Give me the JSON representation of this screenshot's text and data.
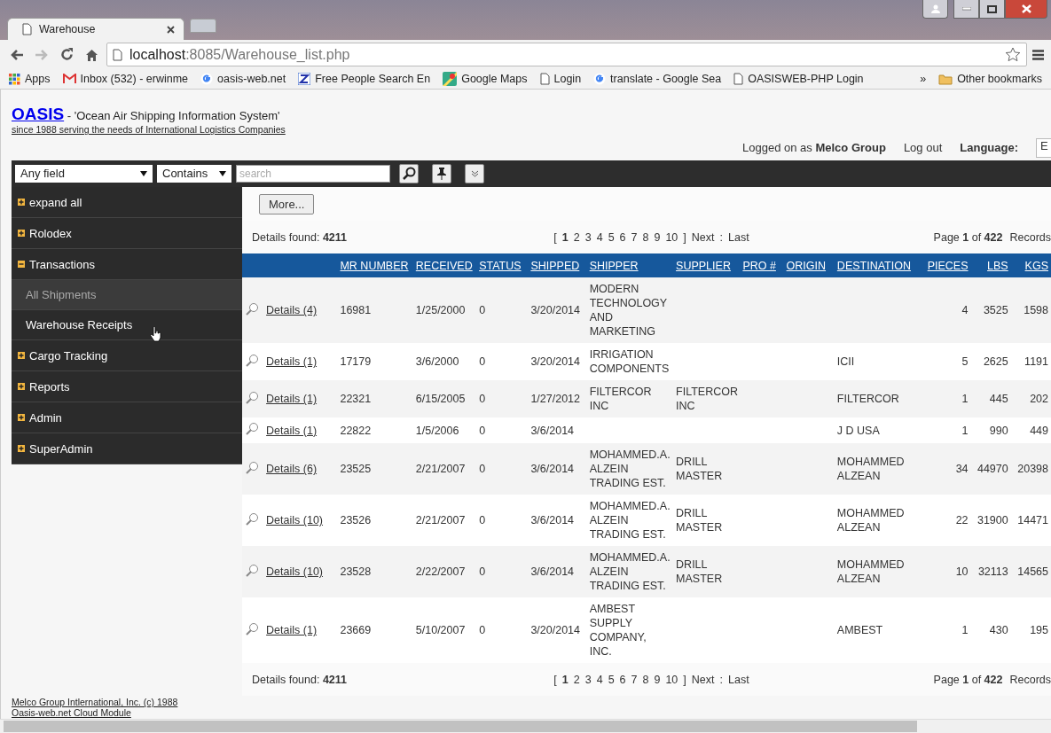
{
  "browser": {
    "tabs": [
      {
        "title": "Warehouse",
        "selected": true
      }
    ],
    "url_host": "localhost",
    "url_path": ":8085/Warehouse_list.php",
    "bookmarks": [
      {
        "kind": "apps",
        "label": "Apps"
      },
      {
        "kind": "mail",
        "label": "Inbox (532) - erwinme"
      },
      {
        "kind": "google",
        "label": "oasis-web.net"
      },
      {
        "kind": "z",
        "label": "Free People Search En"
      },
      {
        "kind": "maps",
        "label": "Google Maps"
      },
      {
        "kind": "page",
        "label": "Login"
      },
      {
        "kind": "google",
        "label": "translate - Google Sea"
      },
      {
        "kind": "page",
        "label": "OASISWEB-PHP Login"
      }
    ],
    "overflow": "»",
    "other_bookmarks": "Other bookmarks"
  },
  "header": {
    "logo": "OASIS",
    "tagline": " - 'Ocean Air Shipping Information System'",
    "subtitle": "since 1988 serving the needs of International Logistics Companies",
    "logged_on": "Logged on as **Melco Group**",
    "logout": "Log out",
    "language_label": "Language:",
    "language_value": "E"
  },
  "search_bar": {
    "field": "Any field",
    "operator": "Contains",
    "placeholder": "search"
  },
  "sidebar": {
    "items": [
      {
        "label": "expand all",
        "expanded": false
      },
      {
        "label": "Rolodex",
        "expanded": false
      },
      {
        "label": "Transactions",
        "expanded": true,
        "children": [
          {
            "label": "All Shipments",
            "selected": true
          },
          {
            "label": "Warehouse Receipts",
            "selected": false
          }
        ]
      },
      {
        "label": "Cargo Tracking",
        "expanded": false
      },
      {
        "label": "Reports",
        "expanded": false
      },
      {
        "label": "Admin",
        "expanded": false
      },
      {
        "label": "SuperAdmin",
        "expanded": false
      }
    ]
  },
  "content": {
    "more_button": "More...",
    "pager_top": {
      "found": "Details found: **4211**",
      "open": "[",
      "pages": [
        {
          "label": "1",
          "selected": true
        },
        {
          "label": "2",
          "selected": false
        },
        {
          "label": "3",
          "selected": false
        },
        {
          "label": "4",
          "selected": false
        },
        {
          "label": "5",
          "selected": false
        },
        {
          "label": "6",
          "selected": false
        },
        {
          "label": "7",
          "selected": false
        },
        {
          "label": "8",
          "selected": false
        },
        {
          "label": "9",
          "selected": false
        },
        {
          "label": "10",
          "selected": false
        }
      ],
      "close": "]",
      "next": "Next",
      "separator": ":",
      "last": "Last",
      "page_info": "Page **1** of **422**",
      "records": "Records"
    },
    "table": {
      "columns": [
        "MR NUMBER",
        "RECEIVED",
        "STATUS",
        "SHIPPED",
        "SHIPPER",
        "SUPPLIER",
        "PRO #",
        "ORIGIN",
        "DESTINATION",
        "PIECES",
        "LBS",
        "KGS"
      ],
      "rows": [
        {
          "details": "Details (4)",
          "cells": [
            "16981",
            "1/25/2000",
            "0",
            "3/20/2014",
            "MODERN TECHNOLOGY AND MARKETING",
            null,
            null,
            null,
            null,
            "4",
            "3525",
            "1598"
          ]
        },
        {
          "details": "Details (1)",
          "cells": [
            "17179",
            "3/6/2000",
            "0",
            "3/20/2014",
            "IRRIGATION COMPONENTS",
            null,
            null,
            null,
            "ICII",
            "5",
            "2625",
            "1191"
          ]
        },
        {
          "details": "Details (1)",
          "cells": [
            "22321",
            "6/15/2005",
            "0",
            "1/27/2012",
            "FILTERCOR INC",
            "FILTERCOR INC",
            null,
            null,
            "FILTERCOR",
            "1",
            "445",
            "202"
          ]
        },
        {
          "details": "Details (1)",
          "cells": [
            "22822",
            "1/5/2006",
            "0",
            "3/6/2014",
            null,
            null,
            null,
            null,
            "J D USA",
            "1",
            "990",
            "449"
          ]
        },
        {
          "details": "Details (6)",
          "cells": [
            "23525",
            "2/21/2007",
            "0",
            "3/6/2014",
            "MOHAMMED.A. ALZEIN TRADING EST.",
            "DRILL MASTER",
            null,
            null,
            "MOHAMMED ALZEAN",
            "34",
            "44970",
            "20398"
          ]
        },
        {
          "details": "Details (10)",
          "cells": [
            "23526",
            "2/21/2007",
            "0",
            "3/6/2014",
            "MOHAMMED.A. ALZEIN TRADING EST.",
            "DRILL MASTER",
            null,
            null,
            "MOHAMMED ALZEAN",
            "22",
            "31900",
            "14471"
          ]
        },
        {
          "details": "Details (10)",
          "cells": [
            "23528",
            "2/22/2007",
            "0",
            "3/6/2014",
            "MOHAMMED.A. ALZEIN TRADING EST.",
            "DRILL MASTER",
            null,
            null,
            "MOHAMMED ALZEAN",
            "10",
            "32113",
            "14565"
          ]
        },
        {
          "details": "Details (1)",
          "cells": [
            "23669",
            "5/10/2007",
            "0",
            "3/20/2014",
            "AMBEST SUPPLY COMPANY, INC.",
            null,
            null,
            null,
            "AMBEST",
            "1",
            "430",
            "195"
          ]
        }
      ]
    },
    "pager_bottom": {
      "found": "Details found: **4211**",
      "open": "[",
      "pages": [
        {
          "label": "1",
          "selected": true
        },
        {
          "label": "2",
          "selected": false
        },
        {
          "label": "3",
          "selected": false
        },
        {
          "label": "4",
          "selected": false
        },
        {
          "label": "5",
          "selected": false
        },
        {
          "label": "6",
          "selected": false
        },
        {
          "label": "7",
          "selected": false
        },
        {
          "label": "8",
          "selected": false
        },
        {
          "label": "9",
          "selected": false
        },
        {
          "label": "10",
          "selected": false
        }
      ],
      "close": "]",
      "next": "Next",
      "separator": ":",
      "last": "Last",
      "page_info": "Page **1** of **422**",
      "records": "Records"
    }
  },
  "footer": {
    "lines": [
      "Melco Group Intlernational, Inc. (c) 1988",
      "Oasis-web.net Cloud Module"
    ]
  }
}
